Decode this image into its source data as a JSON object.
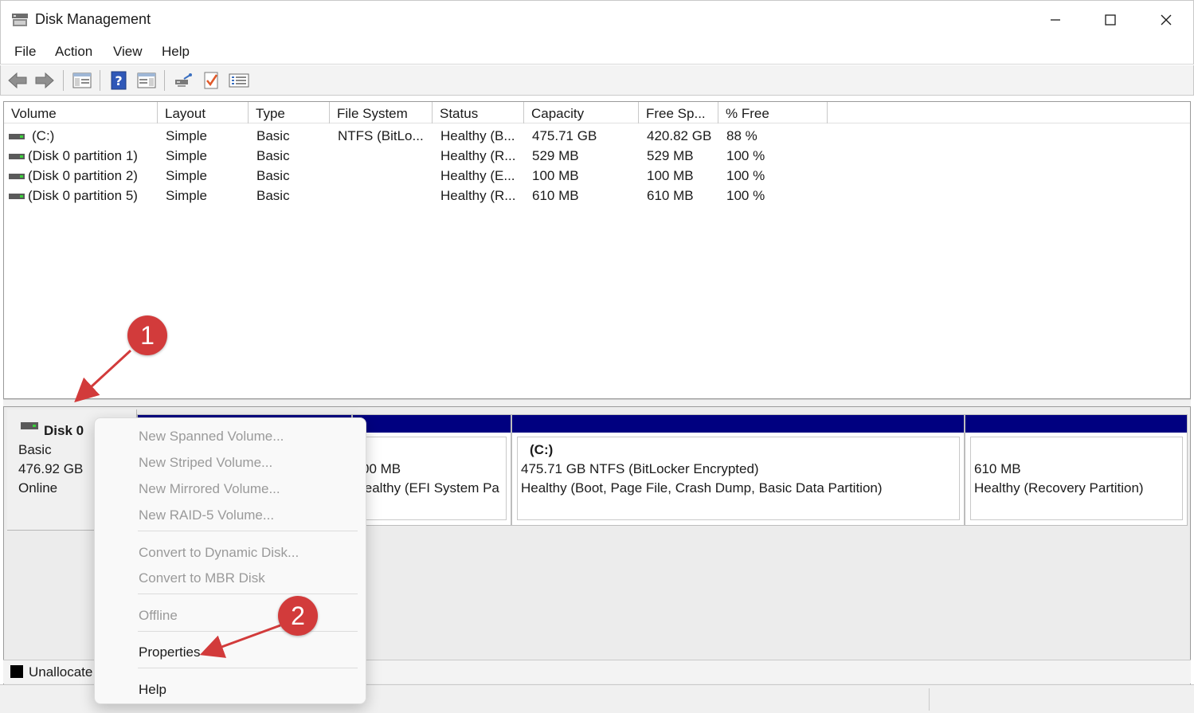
{
  "window": {
    "title": "Disk Management",
    "icon": "disk-management-icon",
    "controls": [
      "minimize-icon",
      "maximize-icon",
      "close-icon"
    ]
  },
  "menubar": {
    "items": [
      "File",
      "Action",
      "View",
      "Help"
    ]
  },
  "toolbar": {
    "buttons": [
      "back-arrow-icon",
      "forward-arrow-icon",
      "show-hide-console-tree-icon",
      "help-icon",
      "show-hide-action-pane-icon",
      "connect-icon",
      "properties-check-icon",
      "list-view-icon"
    ]
  },
  "volume_list": {
    "columns": [
      "Volume",
      "Layout",
      "Type",
      "File System",
      "Status",
      "Capacity",
      "Free Sp...",
      "% Free"
    ],
    "rows": [
      [
        "(C:)",
        "Simple",
        "Basic",
        "NTFS (BitLo...",
        "Healthy (B...",
        "475.71 GB",
        "420.82 GB",
        "88 %"
      ],
      [
        "(Disk 0 partition 1)",
        "Simple",
        "Basic",
        "",
        "Healthy (R...",
        "529 MB",
        "529 MB",
        "100 %"
      ],
      [
        "(Disk 0 partition 2)",
        "Simple",
        "Basic",
        "",
        "Healthy (E...",
        "100 MB",
        "100 MB",
        "100 %"
      ],
      [
        "(Disk 0 partition 5)",
        "Simple",
        "Basic",
        "",
        "Healthy (R...",
        "610 MB",
        "610 MB",
        "100 %"
      ]
    ]
  },
  "disk": {
    "name": "Disk 0",
    "type": "Basic",
    "size": "476.92 GB",
    "state": "Online",
    "partitions": [
      {
        "label": "",
        "line1": "",
        "line2": ""
      },
      {
        "label": "",
        "line1": "00 MB",
        "line2": "lealthy (EFI System Pa"
      },
      {
        "label": "(C:)",
        "line1": "475.71 GB NTFS (BitLocker Encrypted)",
        "line2": "Healthy (Boot, Page File, Crash Dump, Basic Data Partition)"
      },
      {
        "label": "",
        "line1": "610 MB",
        "line2": "Healthy (Recovery Partition)"
      }
    ]
  },
  "legend": {
    "unallocated": "Unallocate"
  },
  "context_menu": {
    "items": [
      {
        "label": "New Spanned Volume...",
        "enabled": false
      },
      {
        "label": "New Striped Volume...",
        "enabled": false
      },
      {
        "label": "New Mirrored Volume...",
        "enabled": false
      },
      {
        "label": "New RAID-5 Volume...",
        "enabled": false
      },
      {
        "label": "Convert to Dynamic Disk...",
        "enabled": false
      },
      {
        "label": "Convert to MBR Disk",
        "enabled": false
      },
      {
        "label": "Offline",
        "enabled": false
      },
      {
        "label": "Properties",
        "enabled": true
      },
      {
        "label": "Help",
        "enabled": true
      }
    ]
  },
  "annotations": {
    "step1": "1",
    "step2": "2",
    "color": "#d23b3b"
  }
}
